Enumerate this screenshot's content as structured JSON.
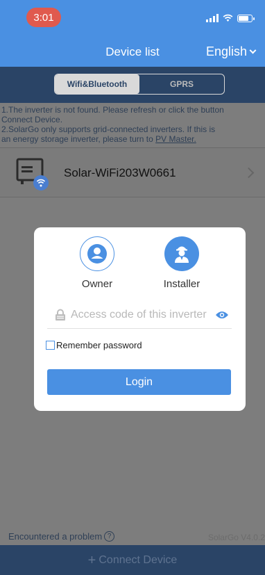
{
  "status_bar": {
    "time": "3:01",
    "battery_level": 0.8
  },
  "nav": {
    "title": "Device list",
    "language": "English"
  },
  "tabs": [
    {
      "label": "Wifi&Bluetooth",
      "active": true
    },
    {
      "label": "GPRS",
      "active": false
    }
  ],
  "notice": {
    "line1": "1.The inverter is not found. Please refresh or click the button",
    "line2": "Connect Device.",
    "line3": "2.SolarGo only supports grid-connected inverters. If this is",
    "line4_prefix": "an energy storage inverter, please turn to ",
    "line4_link": "PV Master."
  },
  "device": {
    "name": "Solar-WiFi203W0661",
    "icon": "inverter-wifi-icon"
  },
  "modal": {
    "roles": [
      {
        "label": "Owner",
        "icon": "owner-person-icon"
      },
      {
        "label": "Installer",
        "icon": "installer-person-icon"
      }
    ],
    "access_code": {
      "placeholder": "Access code of this inverter",
      "value": ""
    },
    "remember_label": "Remember password",
    "remember_checked": false,
    "login_label": "Login"
  },
  "footer": {
    "problem_label": "Encountered a problem",
    "help_glyph": "?",
    "version": "SolarGo V4.0.2"
  },
  "connect": {
    "plus": "+",
    "label": "Connect Device"
  },
  "colors": {
    "primary": "#4a90e2",
    "dark_bar": "#2a4466",
    "time_pill": "#e05a4e"
  }
}
